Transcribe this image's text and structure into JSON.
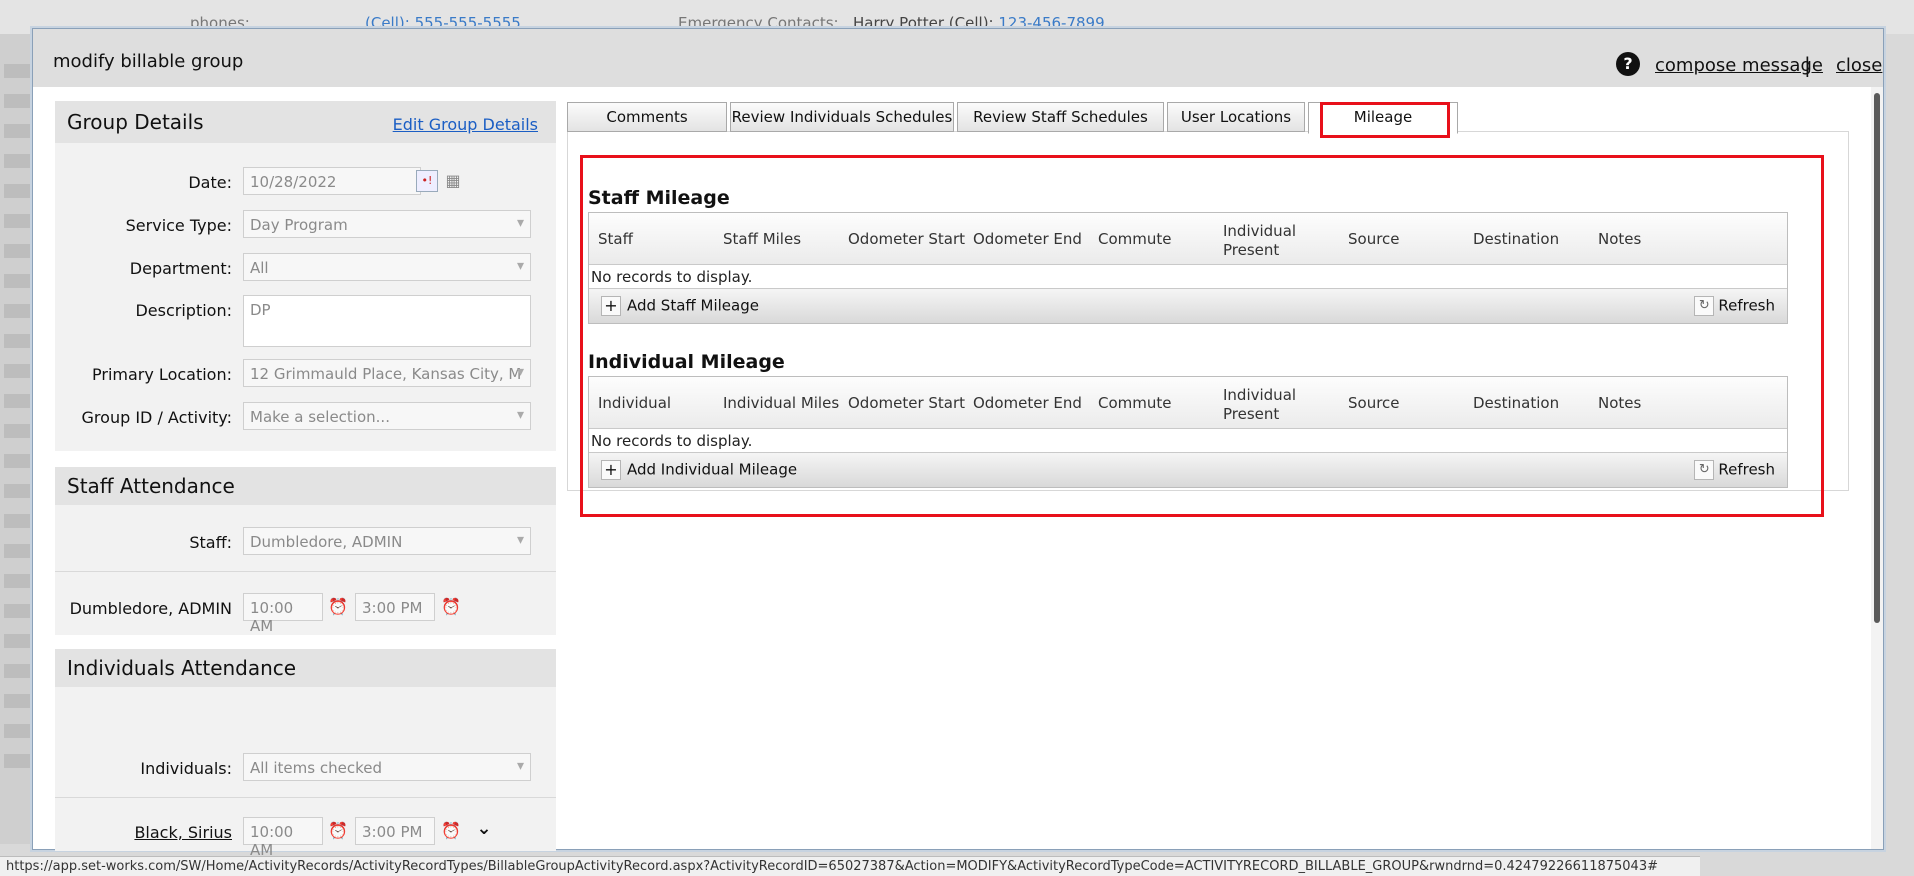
{
  "background": {
    "phones_label": "phones:",
    "phones_value": "(Cell): 555-555-5555",
    "emergency_label": "Emergency Contacts:",
    "emergency_name": "Harry Potter (Cell): ",
    "emergency_phone": "123-456-7899"
  },
  "modal": {
    "title": "modify billable group",
    "help_icon": "question-circle-icon",
    "compose_label": "compose message",
    "separator": "|",
    "close_label": "close"
  },
  "group_details": {
    "heading": "Group Details",
    "edit_link": "Edit Group Details",
    "date_label": "Date:",
    "date_value": "10/28/2022",
    "service_type_label": "Service Type:",
    "service_type_value": "Day Program",
    "department_label": "Department:",
    "department_value": "All",
    "description_label": "Description:",
    "description_value": "DP",
    "primary_location_label": "Primary Location:",
    "primary_location_value": "12 Grimmauld Place, Kansas City, M",
    "group_id_label": "Group ID / Activity:",
    "group_id_placeholder": "Make a selection..."
  },
  "staff_attendance": {
    "heading": "Staff Attendance",
    "staff_label": "Staff:",
    "staff_value": "Dumbledore, ADMIN",
    "member_name": "Dumbledore, ADMIN",
    "start_time": "10:00 AM",
    "end_time": "3:00 PM"
  },
  "individuals_attendance": {
    "heading": "Individuals Attendance",
    "individuals_label": "Individuals:",
    "individuals_value": "All items checked",
    "member_name": "Black, Sirius",
    "start_time": "10:00 AM",
    "end_time": "3:00 PM"
  },
  "tabs": [
    {
      "label": "Comments"
    },
    {
      "label": "Review Individuals Schedules"
    },
    {
      "label": "Review Staff Schedules"
    },
    {
      "label": "User Locations"
    },
    {
      "label": "Mileage"
    }
  ],
  "staff_mileage": {
    "title": "Staff Mileage",
    "columns": [
      "Staff",
      "Staff Miles",
      "Odometer Start",
      "Odometer End",
      "Commute",
      "Individual Present",
      "Source",
      "Destination",
      "Notes"
    ],
    "empty_text": "No records to display.",
    "add_label": "Add Staff Mileage",
    "refresh_label": "Refresh"
  },
  "individual_mileage": {
    "title": "Individual Mileage",
    "columns": [
      "Individual",
      "Individual Miles",
      "Odometer Start",
      "Odometer End",
      "Commute",
      "Individual Present",
      "Source",
      "Destination",
      "Notes"
    ],
    "empty_text": "No records to display.",
    "add_label": "Add Individual Mileage",
    "refresh_label": "Refresh"
  },
  "status_url": "https://app.set-works.com/SW/Home/ActivityRecords/ActivityRecordTypes/BillableGroupActivityRecord.aspx?ActivityRecordID=65027387&Action=MODIFY&ActivityRecordTypeCode=ACTIVITYRECORD_BILLABLE_GROUP&rwndrnd=0.42479226611875043#",
  "colors": {
    "highlight": "#e8101a",
    "link": "#1b5ec4"
  }
}
